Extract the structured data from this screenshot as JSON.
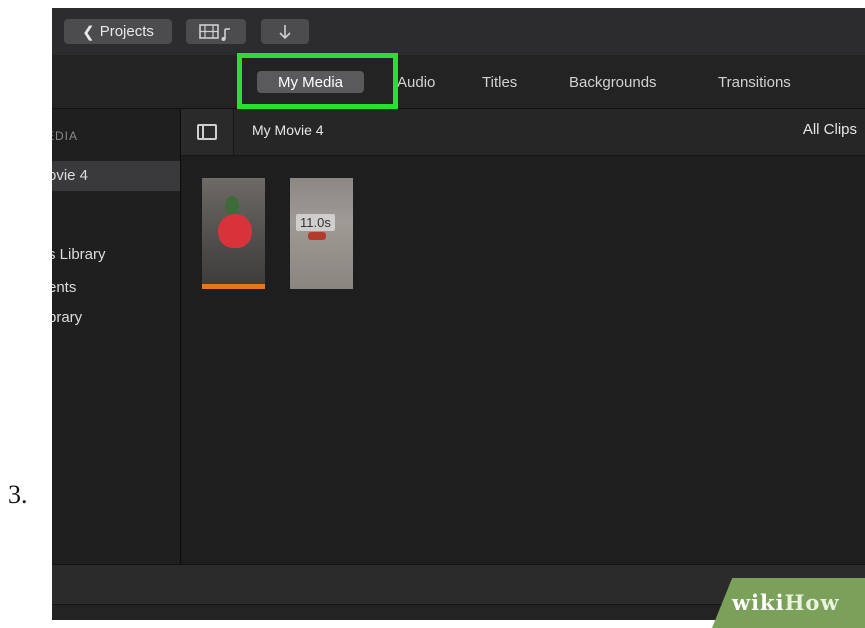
{
  "step": {
    "number": "3."
  },
  "toolbar": {
    "projects_label": "Projects",
    "media_toggle_icons": [
      "film-icon",
      "music-note-icon"
    ],
    "import_icon": "down-arrow-icon"
  },
  "tabs": [
    {
      "label": "My Media",
      "active": true
    },
    {
      "label": "Audio",
      "active": false
    },
    {
      "label": "Titles",
      "active": false
    },
    {
      "label": "Backgrounds",
      "active": false
    },
    {
      "label": "Transitions",
      "active": false
    }
  ],
  "highlight_color": "#27e22c",
  "sidebar": {
    "header": "EDIA",
    "items": [
      {
        "label": "ovie 4",
        "selected": true
      },
      {
        "label": "s Library",
        "selected": false
      },
      {
        "label": "ents",
        "selected": false
      },
      {
        "label": "brary",
        "selected": false
      }
    ]
  },
  "content": {
    "event_title": "My Movie 4",
    "filter": "All Clips",
    "clips": [
      {
        "name": "clip-strawberry",
        "duration": ""
      },
      {
        "name": "clip-toy",
        "duration": "11.0s"
      }
    ]
  },
  "watermark": {
    "part1": "wiki",
    "part2": "How"
  }
}
